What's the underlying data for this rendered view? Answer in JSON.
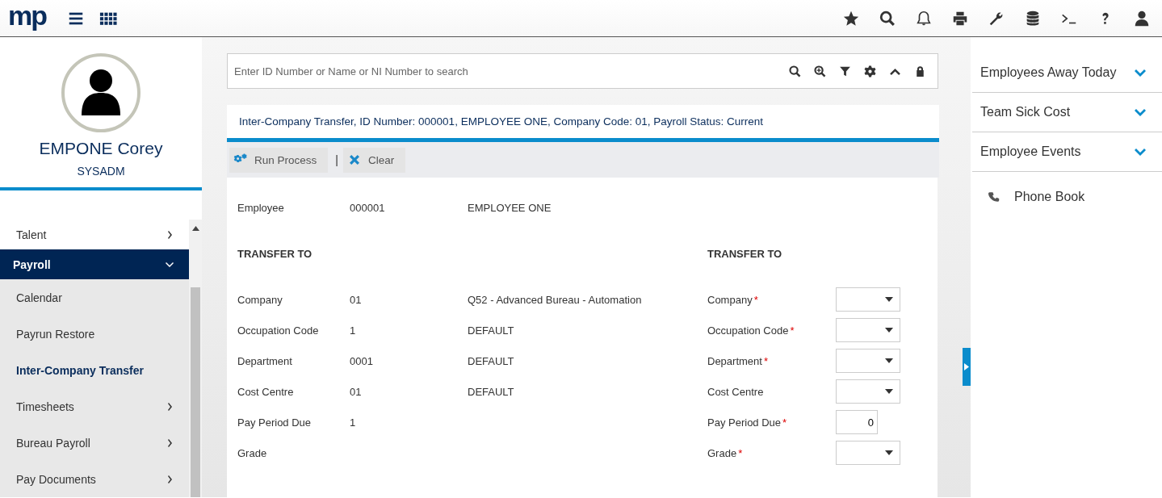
{
  "header": {
    "logo": "mp"
  },
  "profile": {
    "name": "EMPONE Corey",
    "role": "SYSADM"
  },
  "nav": [
    {
      "label": "Talent",
      "kind": "section",
      "selected": false,
      "expanded": false
    },
    {
      "label": "Payroll",
      "kind": "section",
      "selected": true,
      "expanded": true
    },
    {
      "label": "Calendar",
      "kind": "item",
      "selected": false
    },
    {
      "label": "Payrun Restore",
      "kind": "item",
      "selected": false
    },
    {
      "label": "Inter-Company Transfer",
      "kind": "item",
      "selected": true
    },
    {
      "label": "Timesheets",
      "kind": "group",
      "selected": false
    },
    {
      "label": "Bureau Payroll",
      "kind": "group",
      "selected": false
    },
    {
      "label": "Pay Documents",
      "kind": "group",
      "selected": false
    }
  ],
  "search": {
    "placeholder": "Enter ID Number or Name or NI Number to search"
  },
  "context_bar": {
    "text": "Inter-Company Transfer, ID Number: 000001, EMPLOYEE ONE, Company Code: 01, Payroll Status: Current"
  },
  "toolbar": [
    {
      "label": "Run Process",
      "kind": "run"
    },
    {
      "label": "|",
      "kind": "separator"
    },
    {
      "label": "Clear",
      "kind": "clear"
    }
  ],
  "form": {
    "employee": {
      "label": "Employee",
      "id": "000001",
      "name": "EMPLOYEE ONE"
    },
    "left_heading": "TRANSFER TO",
    "right_heading": "TRANSFER TO",
    "fields": [
      {
        "label": "Company",
        "value": "01",
        "description": "Q52 - Advanced Bureau - Automation",
        "target_label": "Company",
        "required_mark": "*",
        "kind": "select"
      },
      {
        "label": "Occupation Code",
        "value": "1",
        "description": "DEFAULT",
        "target_label": "Occupation Code",
        "required_mark": "*",
        "kind": "select"
      },
      {
        "label": "Department",
        "value": "0001",
        "description": "DEFAULT",
        "target_label": "Department",
        "required_mark": "*",
        "kind": "select"
      },
      {
        "label": "Cost Centre",
        "value": "01",
        "description": "DEFAULT",
        "target_label": "Cost Centre",
        "kind": "select"
      },
      {
        "label": "Pay Period Due",
        "value": "1",
        "target_label": "Pay Period Due",
        "required_mark": "*",
        "kind": "input",
        "target_value": "0"
      },
      {
        "label": "Grade",
        "target_label": "Grade",
        "required_mark": "*",
        "kind": "select"
      }
    ]
  },
  "widgets": [
    {
      "label": "Employees Away Today",
      "kind": "collapsible"
    },
    {
      "label": "Team Sick Cost",
      "kind": "collapsible"
    },
    {
      "label": "Employee Events",
      "kind": "collapsible"
    },
    {
      "label": "Phone Book",
      "kind": "link"
    }
  ]
}
